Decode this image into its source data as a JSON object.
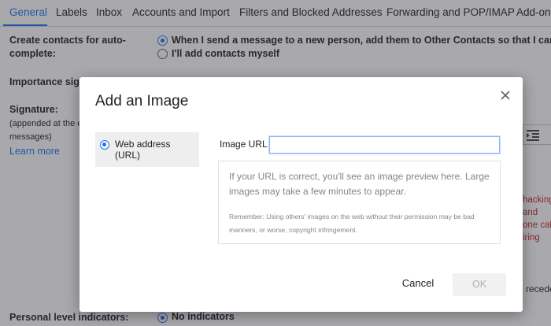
{
  "tabs": [
    "General",
    "Labels",
    "Inbox",
    "Accounts and Import",
    "Filters and Blocked Addresses",
    "Forwarding and POP/IMAP",
    "Add-on"
  ],
  "settings": {
    "create_contacts_label": "Create contacts for auto-complete:",
    "create_contacts_option1": "When I send a message to a new person, add them to Other Contacts so that I can auto",
    "create_contacts_option2": "I'll add contacts myself",
    "importance_label": "Importance sign",
    "signature_label": "Signature:",
    "signature_sub1": "(appended at the e",
    "signature_sub2": "messages)",
    "learn_more": "Learn more",
    "red_lines": [
      "hacking",
      "and",
      "one call",
      "iring"
    ],
    "recede_text": "recede",
    "personal_level_label": "Personal level indicators:",
    "personal_level_option": "No indicators"
  },
  "dialog": {
    "title": "Add an Image",
    "source_option": "Web address (URL)",
    "url_label": "Image URL",
    "url_value": "",
    "preview_text": "If your URL is correct, you'll see an image preview here. Large images may take a few minutes to appear.",
    "preview_note": "Remember: Using others' images on the web without their permission may be bad manners, or worse, copyright infringement.",
    "cancel_label": "Cancel",
    "ok_label": "OK"
  },
  "colors": {
    "accent": "#1a73e8",
    "warning_text": "#c5221f"
  },
  "icons": [
    "close-icon",
    "radio-selected-icon",
    "indent-icon"
  ]
}
